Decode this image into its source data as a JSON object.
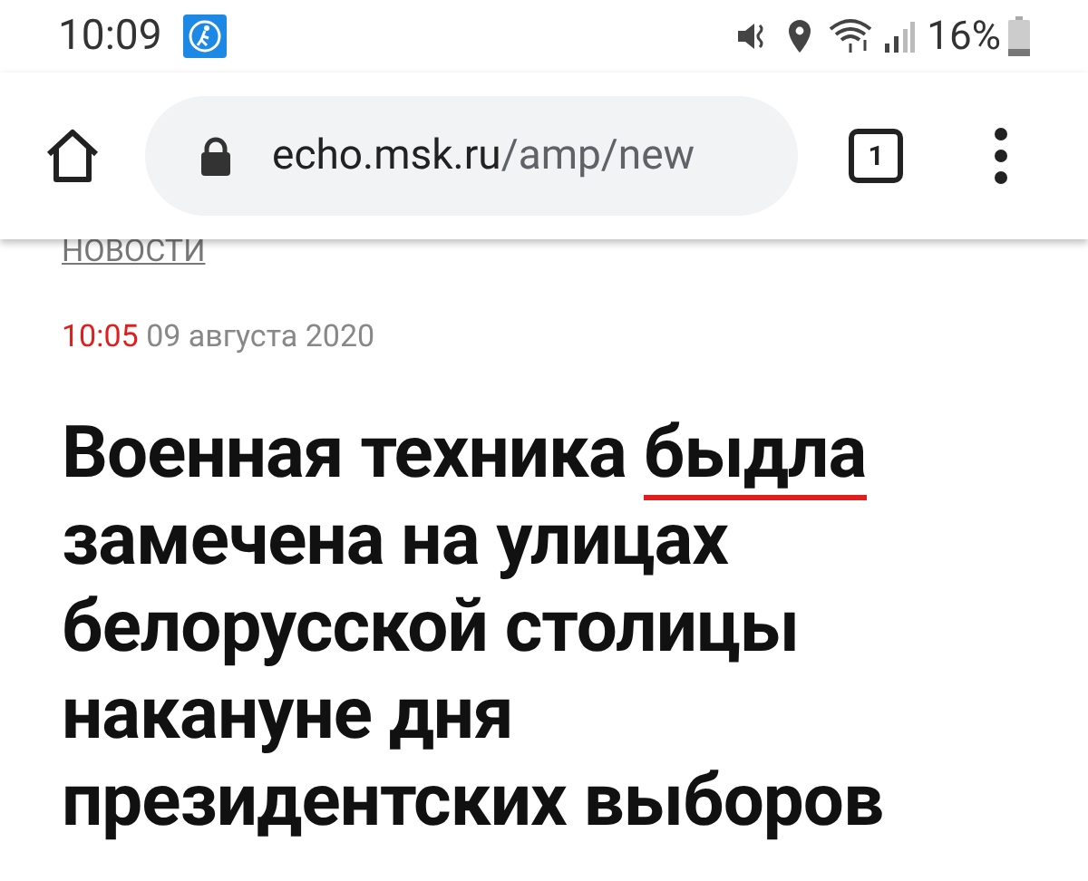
{
  "status_bar": {
    "time": "10:09",
    "battery": "16%"
  },
  "toolbar": {
    "url_host": "echo.msk.ru",
    "url_path": "/amp/new",
    "tab_count": "1"
  },
  "article": {
    "section": "НОВОСТИ",
    "time": "10:05",
    "date": "09 августа 2020",
    "headline_lines": [
      [
        {
          "text": "Военная техника ",
          "underlined": false
        },
        {
          "text": "быдла ",
          "underlined": true
        }
      ],
      [
        {
          "text": "замечена на улицах",
          "underlined": false
        }
      ],
      [
        {
          "text": "белорусской столицы",
          "underlined": false
        }
      ],
      [
        {
          "text": "накануне дня",
          "underlined": false
        }
      ],
      [
        {
          "text": "президентских выборов",
          "underlined": false
        }
      ]
    ]
  }
}
